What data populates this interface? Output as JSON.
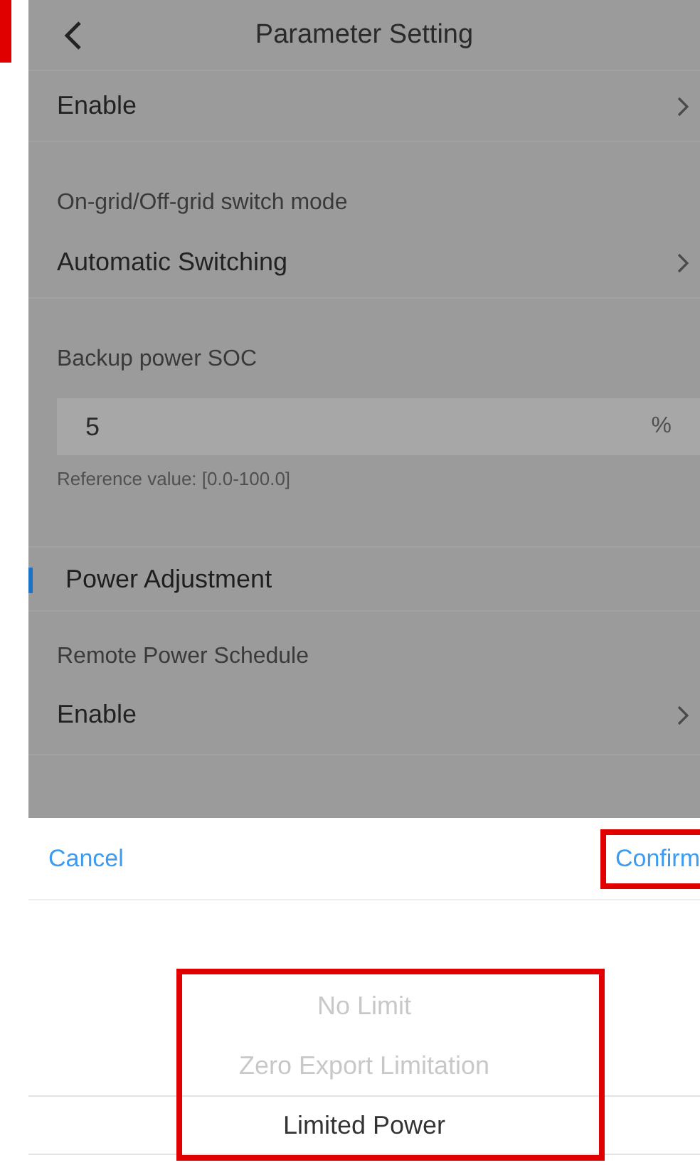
{
  "header": {
    "title": "Parameter Setting"
  },
  "rows": [
    {
      "kind": "value",
      "text": "Enable"
    },
    {
      "kind": "label",
      "text": "On-grid/Off-grid switch mode"
    },
    {
      "kind": "value",
      "text": "Automatic Switching"
    },
    {
      "kind": "label",
      "text": "Backup power SOC"
    },
    {
      "kind": "input",
      "value": "5",
      "unit": "%"
    },
    {
      "kind": "hint",
      "text": "Reference value: [0.0-100.0]"
    },
    {
      "kind": "section",
      "text": "Power Adjustment"
    },
    {
      "kind": "label",
      "text": "Remote Power Schedule"
    },
    {
      "kind": "value",
      "text": "Enable"
    }
  ],
  "sheet": {
    "cancel": "Cancel",
    "confirm": {
      "label": "Confirm",
      "highlighted": true
    },
    "picker": {
      "highlighted": true,
      "options": [
        {
          "label": "No Limit",
          "selected": false
        },
        {
          "label": "Zero Export Limitation",
          "selected": false
        },
        {
          "label": "Limited Power",
          "selected": true
        }
      ]
    }
  }
}
